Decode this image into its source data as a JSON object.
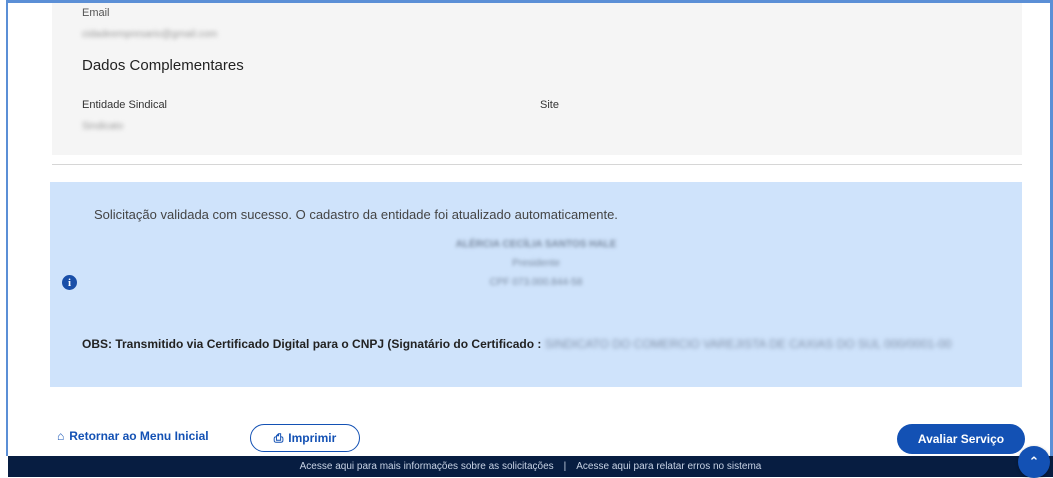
{
  "contact": {
    "email_label": "Email",
    "email_value": "cidadeempresario@gmail.com"
  },
  "complementary": {
    "title": "Dados Complementares",
    "entidade_label": "Entidade Sindical",
    "entidade_value": "Sindicato",
    "site_label": "Site"
  },
  "alert": {
    "message": "Solicitação validada com sucesso. O cadastro da entidade foi atualizado automaticamente.",
    "signatory_name": "ALÉRCIA CECÍLIA SANTOS HALE",
    "signatory_role": "Presidente",
    "signatory_cpf": "CPF 073.000.844-58",
    "obs_label": "OBS: Transmitido via Certificado Digital para o CNPJ (Signatário do Certificado :",
    "obs_value": "SINDICATO DO COMERCIO VAREJISTA DE CAXIAS DO SUL 000/0001-00",
    "icon": "info-circle"
  },
  "actions": {
    "return_label": "Retornar ao Menu Inicial",
    "print_label": "Imprimir",
    "evaluate_label": "Avaliar Serviço",
    "home_icon": "home-icon",
    "printer_icon": "printer-icon"
  },
  "footer": {
    "info_link": "Acesse aqui para mais informações sobre as solicitações",
    "separator": "|",
    "error_link": "Acesse aqui para relatar erros no sistema"
  },
  "colors": {
    "primary": "#1351b4",
    "alert_bg": "#cfe3fb",
    "footer_bg": "#071d41",
    "card_bg": "#f5f5f5"
  }
}
